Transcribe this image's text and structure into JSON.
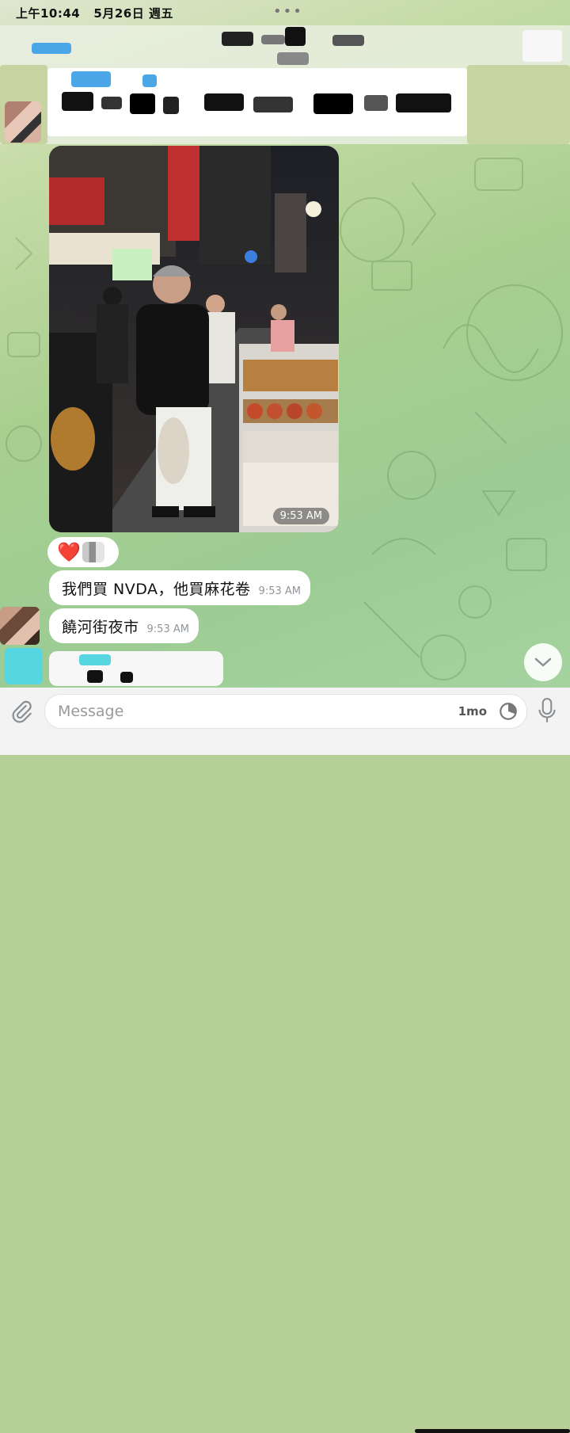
{
  "status_bar": {
    "time": "上午10:44",
    "date": "5月26日 週五",
    "multitask_dots": "•••"
  },
  "photo_message": {
    "alt": "",
    "time": "9:53 AM"
  },
  "reaction": {
    "emoji": "❤️"
  },
  "messages": [
    {
      "text": "我們買 NVDA，他買麻花卷",
      "time": "9:53 AM"
    },
    {
      "text": "饒河街夜市",
      "time": "9:53 AM"
    }
  ],
  "input": {
    "placeholder": "Message",
    "timer_label": "1mo"
  },
  "icons": {
    "attach": "paperclip-icon",
    "timer": "auto-delete-timer-icon",
    "mic": "microphone-icon",
    "scroll_down": "chevron-down-icon"
  }
}
